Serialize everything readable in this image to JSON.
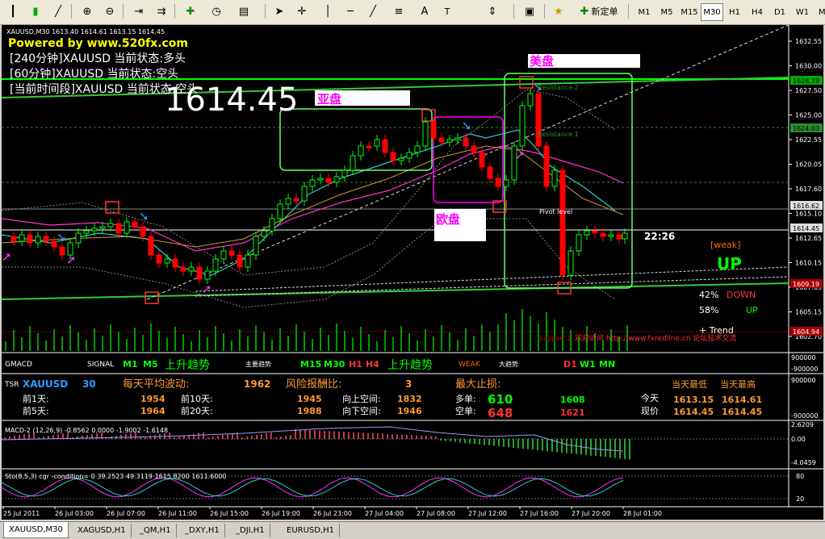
{
  "toolbar": {
    "new_order_label": "新定单",
    "timeframes": [
      "M1",
      "M5",
      "M15",
      "M30",
      "H1",
      "H4",
      "D1",
      "W1",
      "MN"
    ],
    "active_timeframe": "M30"
  },
  "chart": {
    "symbol_line": "XAUUSD,M30  1613.40 1614.61 1613.15 1614.45",
    "powered_by": "Powered by www.520fx.com",
    "status_240": "[240分钟]XAUUSD 当前状态:多头",
    "status_60": "[60分钟]XAUUSD 当前状态:空头",
    "status_current": "[当前时间段]XAUUSD 当前状态:空头",
    "big_price": "1614.45",
    "asia_label": "亚盘",
    "europe_label": "欧盘",
    "us_label": "美盘",
    "resistance2": "Resistance 2",
    "resistance1": "Resistance 1",
    "pivot_label": "Pivot level",
    "support2": "Support 2",
    "website_note": "欢迎访问 http://www.fxredline.cn 论坛技术交流",
    "clock": "22:26",
    "weak_label": "[weak]",
    "up_label": "UP",
    "down_pct": "42%",
    "down_label": "DOWN",
    "up_pct": "58%",
    "up_label2": "UP",
    "trend_label": "+ Trend",
    "price_axis": [
      "1632.55",
      "1630.00",
      "1627.50",
      "1625.00",
      "1622.55",
      "1620.05",
      "1617.60",
      "1615.10",
      "1612.65",
      "1610.15",
      "1607.65",
      "1605.15",
      "1602.70"
    ],
    "price_tags": [
      "1628.78",
      "1624.03",
      "1616.62",
      "1614.45",
      "1609.19",
      "1604.94"
    ]
  },
  "gmacd": {
    "title": "GMACD",
    "signal": "SIGNAL",
    "m1": "M1",
    "m5": "M5",
    "trend_up1": "上升趋势",
    "main_trend": "主要趋势",
    "m15": "M15",
    "m30": "M30",
    "h1": "H1",
    "h4": "H4",
    "trend_up2": "上升趋势",
    "weak": "WEAK",
    "big_trend": "大趋势",
    "d1": "D1",
    "w1": "W1",
    "mn": "MN",
    "axis_top": "900000",
    "axis_bottom": "-900000"
  },
  "tsr": {
    "title": "TSR",
    "symbol": "XAUUSD",
    "period": "30",
    "daily_range_label": "每天平均波动:",
    "daily_range_value": "1962",
    "risk_label": "风险报酬比:",
    "risk_value": "3",
    "max_stop_label": "最大止损:",
    "day_low_label": "当天最低",
    "day_high_label": "当天最高",
    "prev1_label": "前1天:",
    "prev1_value": "1954",
    "prev10_label": "前10天:",
    "prev10_value": "1945",
    "up_space_label": "向上空间:",
    "up_space_value": "1832",
    "long_label": "多单:",
    "long_value": "610",
    "long_value2": "1608",
    "today_label": "今天",
    "today_low": "1613.15",
    "today_high": "1614.61",
    "prev5_label": "前5天:",
    "prev5_value": "1964",
    "prev20_label": "前20天:",
    "prev20_value": "1988",
    "down_space_label": "向下空间:",
    "down_space_value": "1946",
    "short_label": "空单:",
    "short_value": "648",
    "short_value2": "1621",
    "current_label": "现价",
    "current_low": "1614.45",
    "current_high": "1614.45",
    "axis_top": "900000",
    "axis_bottom": "-900000"
  },
  "macd": {
    "title": "MACD-2 (12,26,9) -0.8562 0.0000 -1.9002 -1.6148",
    "axis": [
      "2.6209",
      "0.00",
      "-4.0459"
    ]
  },
  "stoch": {
    "title": "Sto(8,5,3) cgr -condition= 0  39.2523 49.3119 1615.8200 1611.6000",
    "axis": [
      "80",
      "20"
    ]
  },
  "time_axis": [
    "25 Jul 2011",
    "26 Jul 03:00",
    "26 Jul 07:00",
    "26 Jul 11:00",
    "26 Jul 15:00",
    "26 Jul 19:00",
    "26 Jul 23:00",
    "27 Jul 04:00",
    "27 Jul 08:00",
    "27 Jul 12:00",
    "27 Jul 16:00",
    "27 Jul 20:00",
    "28 Jul 01:00"
  ],
  "tabs": [
    "XAUUSD,M30",
    "XAGUSD,H1",
    "_QM,H1",
    "_DXY,H1",
    "_DJI,H1",
    "EURUSD,H1"
  ],
  "colors": {
    "bull": "#00ff00",
    "bear": "#ff0000",
    "box": "#66ff66",
    "magenta": "#ff00ff"
  }
}
